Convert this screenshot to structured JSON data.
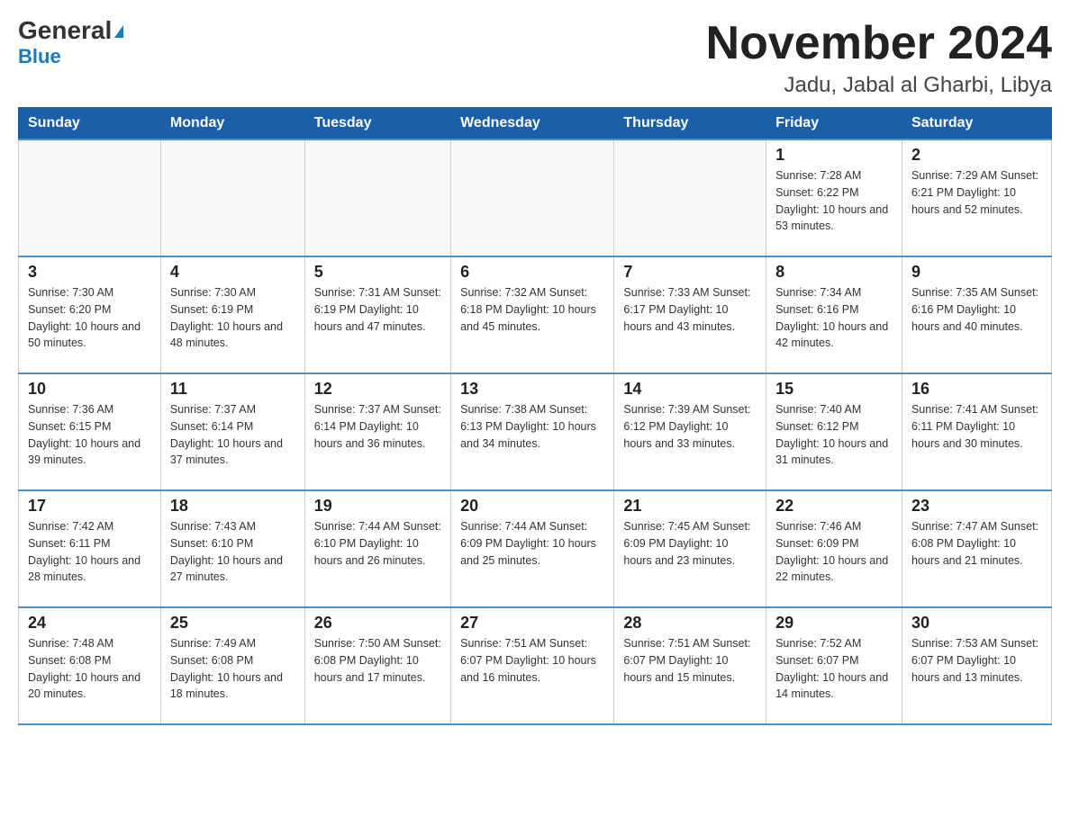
{
  "logo": {
    "general": "General",
    "blue": "Blue",
    "triangle": "▶"
  },
  "title": "November 2024",
  "subtitle": "Jadu, Jabal al Gharbi, Libya",
  "days_of_week": [
    "Sunday",
    "Monday",
    "Tuesday",
    "Wednesday",
    "Thursday",
    "Friday",
    "Saturday"
  ],
  "weeks": [
    [
      {
        "day": "",
        "info": ""
      },
      {
        "day": "",
        "info": ""
      },
      {
        "day": "",
        "info": ""
      },
      {
        "day": "",
        "info": ""
      },
      {
        "day": "",
        "info": ""
      },
      {
        "day": "1",
        "info": "Sunrise: 7:28 AM\nSunset: 6:22 PM\nDaylight: 10 hours and 53 minutes."
      },
      {
        "day": "2",
        "info": "Sunrise: 7:29 AM\nSunset: 6:21 PM\nDaylight: 10 hours and 52 minutes."
      }
    ],
    [
      {
        "day": "3",
        "info": "Sunrise: 7:30 AM\nSunset: 6:20 PM\nDaylight: 10 hours and 50 minutes."
      },
      {
        "day": "4",
        "info": "Sunrise: 7:30 AM\nSunset: 6:19 PM\nDaylight: 10 hours and 48 minutes."
      },
      {
        "day": "5",
        "info": "Sunrise: 7:31 AM\nSunset: 6:19 PM\nDaylight: 10 hours and 47 minutes."
      },
      {
        "day": "6",
        "info": "Sunrise: 7:32 AM\nSunset: 6:18 PM\nDaylight: 10 hours and 45 minutes."
      },
      {
        "day": "7",
        "info": "Sunrise: 7:33 AM\nSunset: 6:17 PM\nDaylight: 10 hours and 43 minutes."
      },
      {
        "day": "8",
        "info": "Sunrise: 7:34 AM\nSunset: 6:16 PM\nDaylight: 10 hours and 42 minutes."
      },
      {
        "day": "9",
        "info": "Sunrise: 7:35 AM\nSunset: 6:16 PM\nDaylight: 10 hours and 40 minutes."
      }
    ],
    [
      {
        "day": "10",
        "info": "Sunrise: 7:36 AM\nSunset: 6:15 PM\nDaylight: 10 hours and 39 minutes."
      },
      {
        "day": "11",
        "info": "Sunrise: 7:37 AM\nSunset: 6:14 PM\nDaylight: 10 hours and 37 minutes."
      },
      {
        "day": "12",
        "info": "Sunrise: 7:37 AM\nSunset: 6:14 PM\nDaylight: 10 hours and 36 minutes."
      },
      {
        "day": "13",
        "info": "Sunrise: 7:38 AM\nSunset: 6:13 PM\nDaylight: 10 hours and 34 minutes."
      },
      {
        "day": "14",
        "info": "Sunrise: 7:39 AM\nSunset: 6:12 PM\nDaylight: 10 hours and 33 minutes."
      },
      {
        "day": "15",
        "info": "Sunrise: 7:40 AM\nSunset: 6:12 PM\nDaylight: 10 hours and 31 minutes."
      },
      {
        "day": "16",
        "info": "Sunrise: 7:41 AM\nSunset: 6:11 PM\nDaylight: 10 hours and 30 minutes."
      }
    ],
    [
      {
        "day": "17",
        "info": "Sunrise: 7:42 AM\nSunset: 6:11 PM\nDaylight: 10 hours and 28 minutes."
      },
      {
        "day": "18",
        "info": "Sunrise: 7:43 AM\nSunset: 6:10 PM\nDaylight: 10 hours and 27 minutes."
      },
      {
        "day": "19",
        "info": "Sunrise: 7:44 AM\nSunset: 6:10 PM\nDaylight: 10 hours and 26 minutes."
      },
      {
        "day": "20",
        "info": "Sunrise: 7:44 AM\nSunset: 6:09 PM\nDaylight: 10 hours and 25 minutes."
      },
      {
        "day": "21",
        "info": "Sunrise: 7:45 AM\nSunset: 6:09 PM\nDaylight: 10 hours and 23 minutes."
      },
      {
        "day": "22",
        "info": "Sunrise: 7:46 AM\nSunset: 6:09 PM\nDaylight: 10 hours and 22 minutes."
      },
      {
        "day": "23",
        "info": "Sunrise: 7:47 AM\nSunset: 6:08 PM\nDaylight: 10 hours and 21 minutes."
      }
    ],
    [
      {
        "day": "24",
        "info": "Sunrise: 7:48 AM\nSunset: 6:08 PM\nDaylight: 10 hours and 20 minutes."
      },
      {
        "day": "25",
        "info": "Sunrise: 7:49 AM\nSunset: 6:08 PM\nDaylight: 10 hours and 18 minutes."
      },
      {
        "day": "26",
        "info": "Sunrise: 7:50 AM\nSunset: 6:08 PM\nDaylight: 10 hours and 17 minutes."
      },
      {
        "day": "27",
        "info": "Sunrise: 7:51 AM\nSunset: 6:07 PM\nDaylight: 10 hours and 16 minutes."
      },
      {
        "day": "28",
        "info": "Sunrise: 7:51 AM\nSunset: 6:07 PM\nDaylight: 10 hours and 15 minutes."
      },
      {
        "day": "29",
        "info": "Sunrise: 7:52 AM\nSunset: 6:07 PM\nDaylight: 10 hours and 14 minutes."
      },
      {
        "day": "30",
        "info": "Sunrise: 7:53 AM\nSunset: 6:07 PM\nDaylight: 10 hours and 13 minutes."
      }
    ]
  ]
}
